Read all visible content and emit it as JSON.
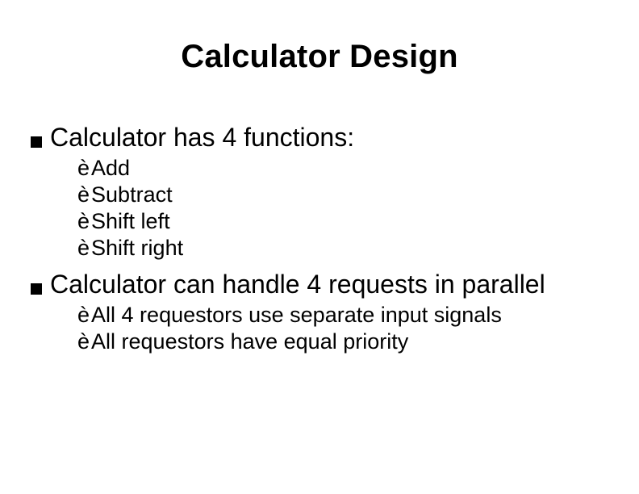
{
  "title": "Calculator Design",
  "points": [
    {
      "text": "Calculator has 4 functions:",
      "sub": [
        "Add",
        "Subtract",
        "Shift left",
        "Shift right"
      ]
    },
    {
      "text": "Calculator can handle 4 requests in parallel",
      "sub": [
        "All 4 requestors use separate input signals",
        "All requestors have equal priority"
      ]
    }
  ],
  "glyphs": {
    "arrow": "è"
  }
}
